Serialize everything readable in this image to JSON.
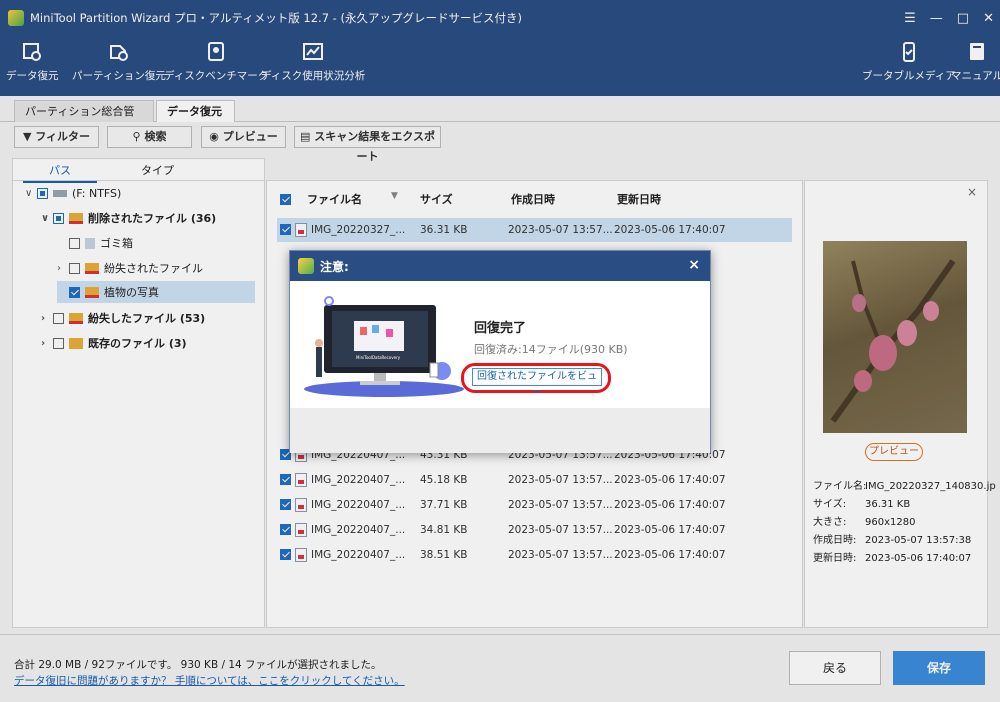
{
  "titlebar": {
    "title": "MiniTool Partition Wizard プロ・アルティメット版 12.7 - (永久アップグレードサービス付き)"
  },
  "toolbar": {
    "items": [
      {
        "label": "データ復元"
      },
      {
        "label": "パーティション復元"
      },
      {
        "label": "ディスクベンチマーク"
      },
      {
        "label": "ディスク使用状況分析"
      },
      {
        "label": "ブータブルメディア"
      },
      {
        "label": "マニュアル"
      }
    ]
  },
  "tabs": [
    {
      "label": "パーティション総合管理"
    },
    {
      "label": "データ復元",
      "close": "×"
    }
  ],
  "buttons": {
    "filter": "フィルター",
    "search": "検索",
    "preview": "プレビュー",
    "export": "スキャン結果をエクスポート"
  },
  "left_panel": {
    "tab_path": "パス",
    "tab_type": "タイプ",
    "tree": [
      {
        "label": "(F: NTFS)"
      },
      {
        "label": "削除されたファイル (36)"
      },
      {
        "label": "ゴミ箱"
      },
      {
        "label": "紛失されたファイル"
      },
      {
        "label": "植物の写真"
      },
      {
        "label": "紛失したファイル (53)"
      },
      {
        "label": "既存のファイル (3)"
      }
    ]
  },
  "table": {
    "headers": {
      "name": "ファイル名",
      "size": "サイズ",
      "created": "作成日時",
      "modified": "更新日時"
    },
    "rows": [
      {
        "name": "IMG_20220327_...",
        "size": "36.31 KB",
        "created": "2023-05-07 13:57...",
        "modified": "2023-05-06 17:40:07"
      },
      {
        "name": "IMG_20220407_...",
        "size": "43.31 KB",
        "created": "2023-05-07 13:57...",
        "modified": "2023-05-06 17:40:07"
      },
      {
        "name": "IMG_20220407_...",
        "size": "45.18 KB",
        "created": "2023-05-07 13:57...",
        "modified": "2023-05-06 17:40:07"
      },
      {
        "name": "IMG_20220407_...",
        "size": "37.71 KB",
        "created": "2023-05-07 13:57...",
        "modified": "2023-05-06 17:40:07"
      },
      {
        "name": "IMG_20220407_...",
        "size": "34.81 KB",
        "created": "2023-05-07 13:57...",
        "modified": "2023-05-06 17:40:07"
      },
      {
        "name": "IMG_20220407_...",
        "size": "38.51 KB",
        "created": "2023-05-07 13:57...",
        "modified": "2023-05-06 17:40:07"
      }
    ]
  },
  "preview_panel": {
    "close": "×",
    "preview_button": "プレビュー",
    "info": [
      {
        "k": "ファイル名:",
        "v": "IMG_20220327_140830.jp"
      },
      {
        "k": "サイズ:",
        "v": "36.31 KB"
      },
      {
        "k": "大きさ:",
        "v": "960x1280"
      },
      {
        "k": "作成日時:",
        "v": "2023-05-07 13:57:38"
      },
      {
        "k": "更新日時:",
        "v": "2023-05-06 17:40:07"
      }
    ]
  },
  "status": {
    "summary": "合計 29.0 MB / 92ファイルです。 930 KB / 14 ファイルが選択されました。",
    "help_link": "データ復旧に問題がありますか？ 手順については、ここをクリックしてください。",
    "back": "戻る",
    "save": "保存"
  },
  "dialog": {
    "title": "注意:",
    "close": "×",
    "heading": "回復完了",
    "sub": "回復済み:14ファイル(930 KB)",
    "link": "回復されたファイルをビュー",
    "illus_text": "MiniToolDataRecovery"
  },
  "colors": {
    "accent": "#2a4e83",
    "highlight": "#e8141e",
    "primary_button": "#3c8dde"
  }
}
